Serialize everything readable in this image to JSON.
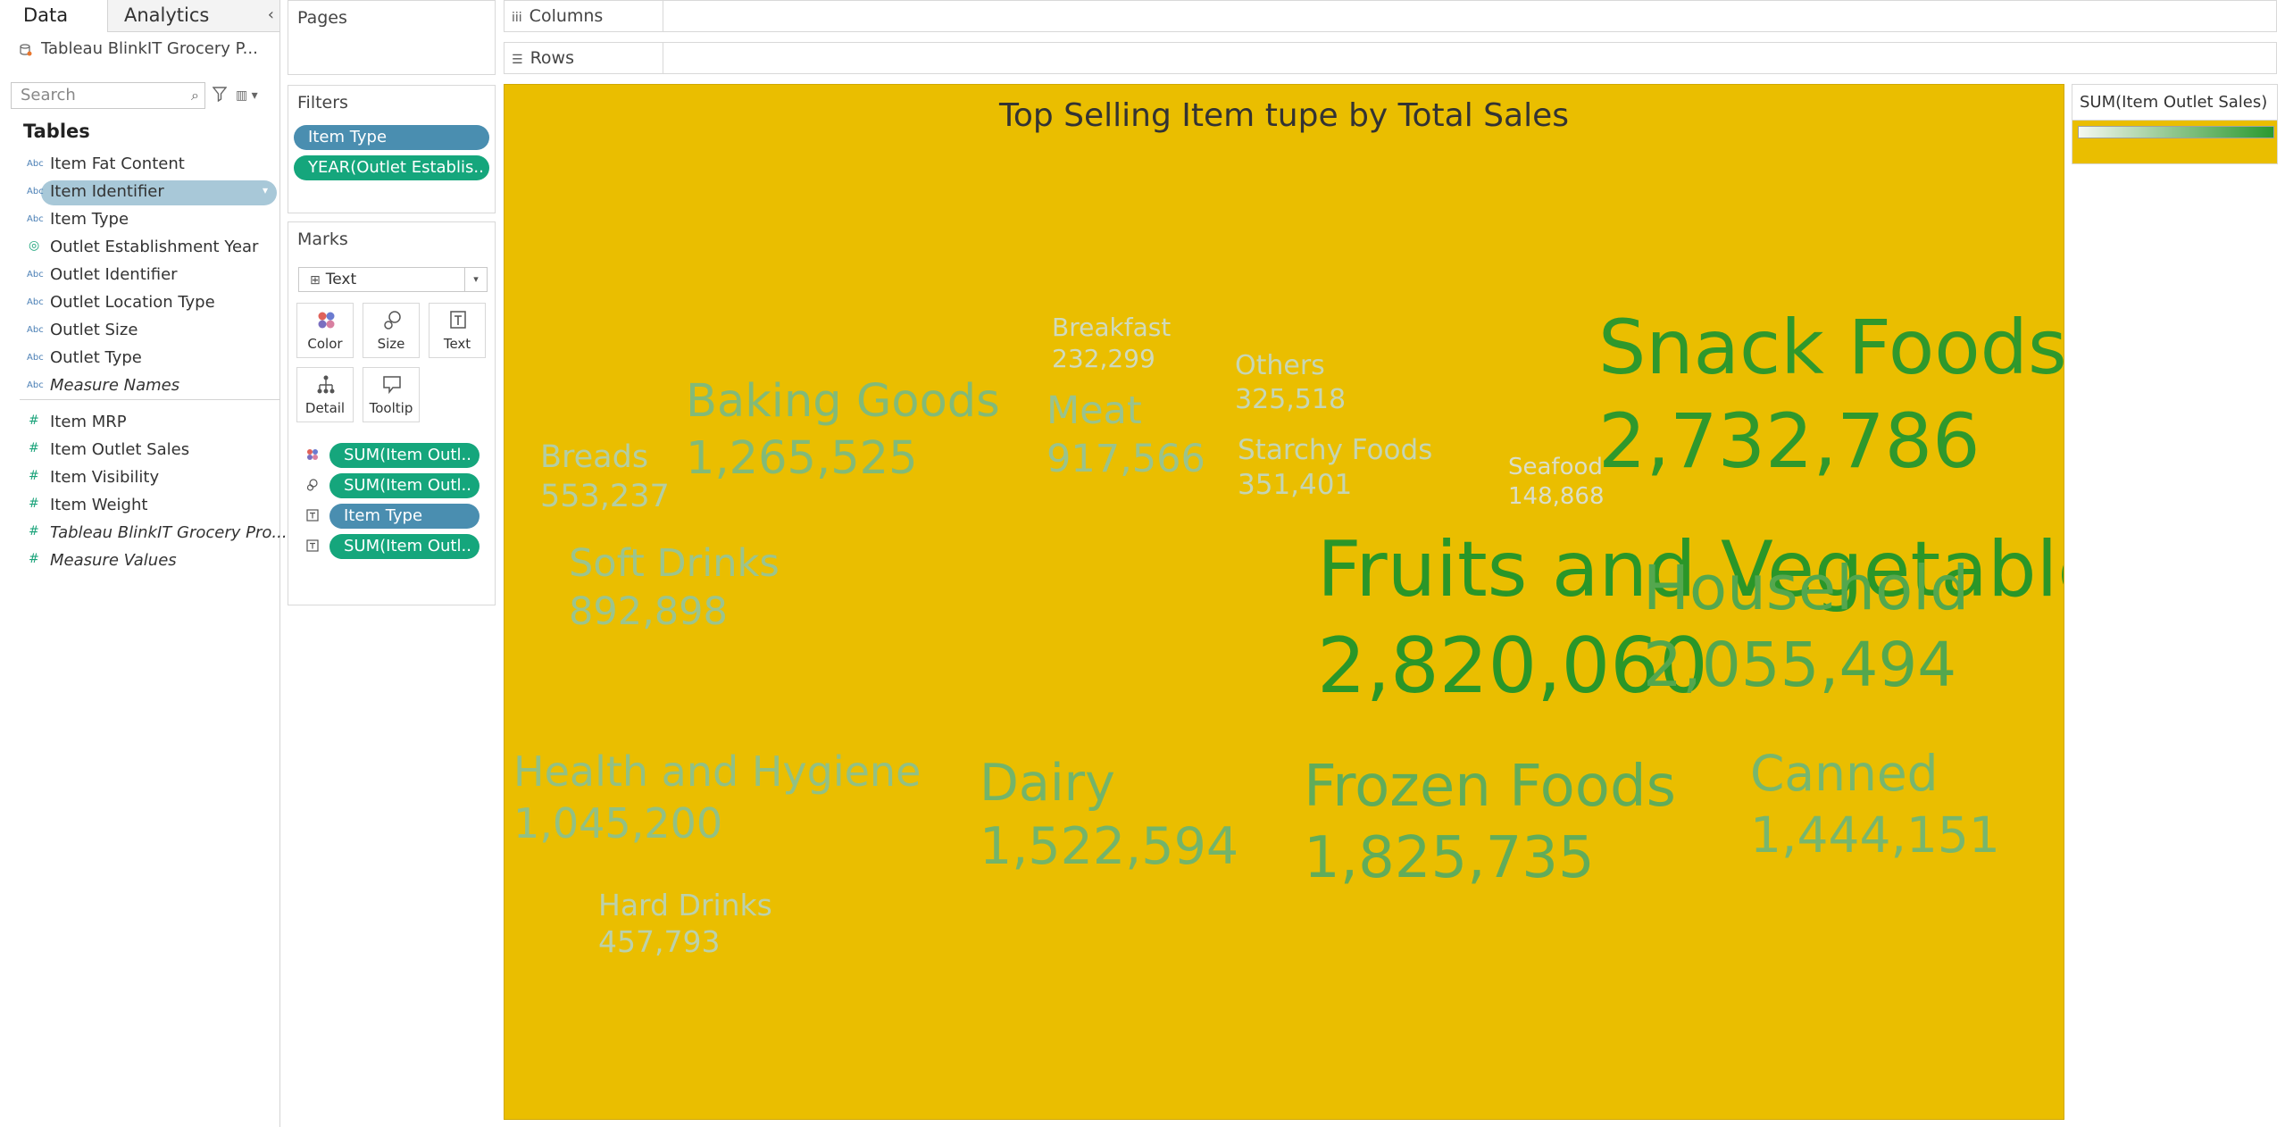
{
  "tabs": {
    "data": "Data",
    "analytics": "Analytics"
  },
  "datasource": "Tableau BlinkIT Grocery P...",
  "search": {
    "placeholder": "Search"
  },
  "tables_title": "Tables",
  "dimensions": [
    {
      "label": "Item Fat Content",
      "type": "Abc"
    },
    {
      "label": "Item Identifier",
      "type": "Abc",
      "selected": true
    },
    {
      "label": "Item Type",
      "type": "Abc"
    },
    {
      "label": "Outlet Establishment Year",
      "type": "date"
    },
    {
      "label": "Outlet Identifier",
      "type": "Abc"
    },
    {
      "label": "Outlet Location Type",
      "type": "Abc"
    },
    {
      "label": "Outlet Size",
      "type": "Abc"
    },
    {
      "label": "Outlet Type",
      "type": "Abc"
    },
    {
      "label": "Measure Names",
      "type": "Abc",
      "italic": true
    }
  ],
  "measures": [
    {
      "label": "Item MRP"
    },
    {
      "label": "Item Outlet Sales"
    },
    {
      "label": "Item Visibility"
    },
    {
      "label": "Item Weight"
    },
    {
      "label": "Tableau BlinkIT Grocery Pro...",
      "italic": true
    },
    {
      "label": "Measure Values",
      "italic": true
    }
  ],
  "cards": {
    "pages": "Pages",
    "filters": "Filters",
    "marks": "Marks"
  },
  "filters": [
    "Item Type",
    "YEAR(Outlet Establis.."
  ],
  "marks": {
    "type": "Text",
    "buttons": [
      "Color",
      "Size",
      "Text",
      "Detail",
      "Tooltip"
    ],
    "fields": [
      {
        "icon": "color",
        "label": "SUM(Item Outl..",
        "kind": "green"
      },
      {
        "icon": "size",
        "label": "SUM(Item Outl..",
        "kind": "green"
      },
      {
        "icon": "text",
        "label": "Item Type",
        "kind": "blue"
      },
      {
        "icon": "text",
        "label": "SUM(Item Outl..",
        "kind": "green"
      }
    ]
  },
  "shelves": {
    "columns": "Columns",
    "rows": "Rows"
  },
  "legend": {
    "title": "SUM(Item Outlet Sales)"
  },
  "colors": {
    "viz_background": "#eabe00",
    "measure_pill": "#15a67c",
    "dimension_pill": "#4a8eb0"
  },
  "chart_data": {
    "type": "word-cloud",
    "title": "Top Selling Item tupe by Total Sales",
    "categories": [
      "Fruits and Vegetables",
      "Snack Foods",
      "Household",
      "Frozen Foods",
      "Dairy",
      "Canned",
      "Baking Goods",
      "Health and Hygiene",
      "Meat",
      "Soft Drinks",
      "Breads",
      "Hard Drinks",
      "Starchy Foods",
      "Others",
      "Breakfast",
      "Seafood"
    ],
    "values": [
      2820060,
      2732786,
      2055494,
      1825735,
      1522594,
      1444151,
      1265525,
      1045200,
      917566,
      892898,
      553237,
      457793,
      351401,
      325518,
      232299,
      148868
    ],
    "labels": [
      "2,820,060",
      "2,732,786",
      "2,055,494",
      "1,825,735",
      "1,522,594",
      "1,444,151",
      "1,265,525",
      "1,045,200",
      "917,566",
      "892,898",
      "553,237",
      "457,793",
      "351,401",
      "325,518",
      "232,299",
      "148,868"
    ],
    "color_measure": "SUM(Item Outlet Sales)"
  }
}
